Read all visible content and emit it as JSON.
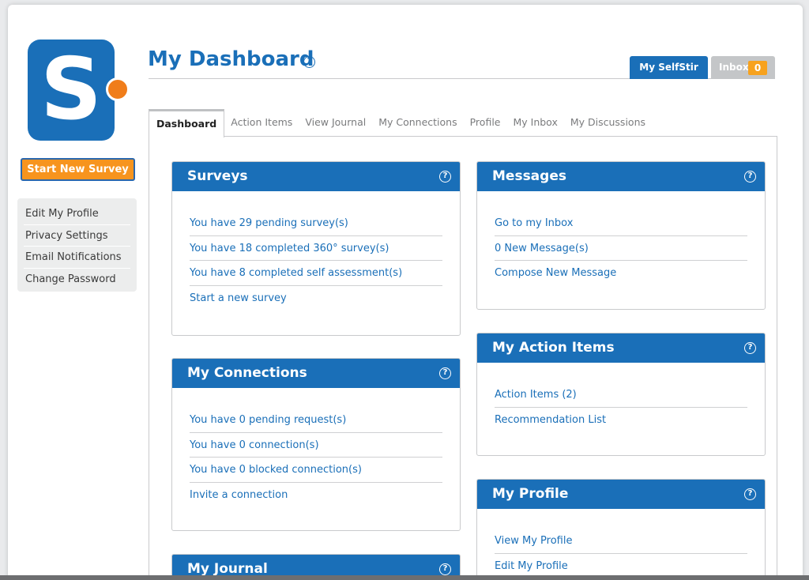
{
  "logo": {
    "letter": "S"
  },
  "sidebar": {
    "start_button": "Start New Survey",
    "items": [
      {
        "label": "Edit My Profile"
      },
      {
        "label": "Privacy Settings"
      },
      {
        "label": "Email Notifications"
      },
      {
        "label": "Change Password"
      }
    ]
  },
  "header": {
    "title": "My Dashboard",
    "help": "?",
    "my_tab": "My SelfStir",
    "inbox_tab": "Inbox",
    "inbox_count": "0"
  },
  "nav": {
    "tabs": [
      {
        "label": "Dashboard",
        "active": true
      },
      {
        "label": "Action Items"
      },
      {
        "label": "View Journal"
      },
      {
        "label": "My Connections"
      },
      {
        "label": "Profile"
      },
      {
        "label": "My Inbox"
      },
      {
        "label": "My Discussions"
      }
    ]
  },
  "widgets": {
    "surveys": {
      "title": "Surveys",
      "links": [
        "You have 29 pending survey(s)",
        "You have 18 completed 360° survey(s)",
        "You have 8 completed self assessment(s)",
        "Start a new survey"
      ]
    },
    "connections": {
      "title": "My Connections",
      "links": [
        "You have 0 pending request(s)",
        "You have 0 connection(s)",
        "You have 0 blocked connection(s)",
        "Invite a connection"
      ]
    },
    "journal": {
      "title": "My Journal"
    },
    "messages": {
      "title": "Messages",
      "links": [
        "Go to my Inbox",
        "0 New Message(s)",
        "Compose New Message"
      ]
    },
    "action_items": {
      "title": "My Action Items",
      "links": [
        "Action Items (2)",
        "Recommendation List"
      ]
    },
    "profile": {
      "title": "My Profile",
      "links": [
        "View My Profile",
        "Edit My Profile"
      ]
    }
  },
  "colors": {
    "brand_blue": "#1a6fb8",
    "accent_orange": "#f7941e",
    "inbox_badge": "#f7a21e"
  }
}
